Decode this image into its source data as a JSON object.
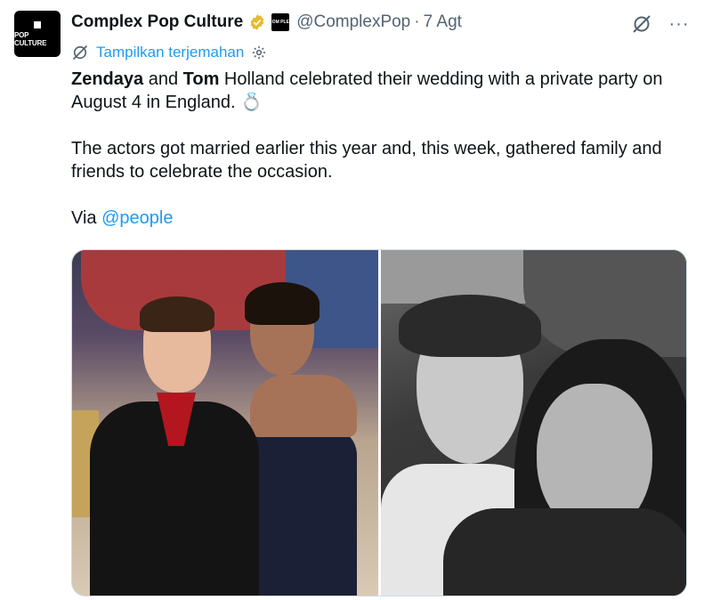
{
  "account": {
    "avatar_text": "POP CULTURE",
    "display_name": "Complex Pop Culture",
    "affiliate_badge_text": "COM PLEX",
    "handle": "@ComplexPop",
    "separator": "·",
    "timestamp": "7 Agt"
  },
  "actions": {
    "grok_icon": "grok-icon",
    "more_label": "···"
  },
  "translate": {
    "label": "Tampilkan terjemahan"
  },
  "tweet": {
    "p1_bold1": "Zendaya",
    "p1_text1": " and ",
    "p1_bold2": "Tom",
    "p1_text2": " Holland celebrated their wedding with a private party on August 4 in England. ",
    "p1_emoji": "💍",
    "p2": "The actors got married earlier this year and, this week, gathered family and friends to celebrate the occasion.",
    "p3_prefix": "Via ",
    "p3_mention": "@people"
  },
  "colors": {
    "accent": "#1d9bf0",
    "text": "#0f1419",
    "secondary": "#536471",
    "verified_gold": "#e8b92a"
  }
}
